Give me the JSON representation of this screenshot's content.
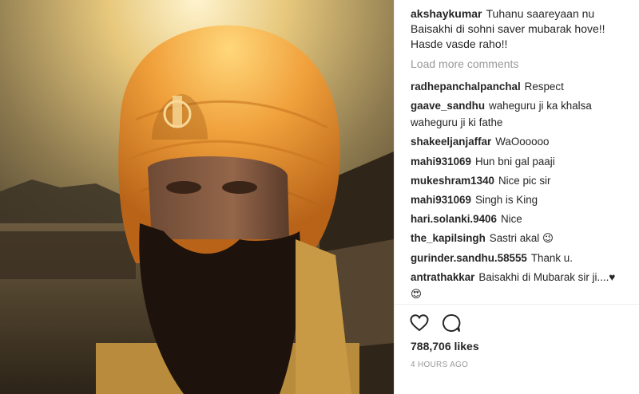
{
  "caption": {
    "username": "akshaykumar",
    "text": "Tuhanu saareyaan nu Baisakhi di sohni saver mubarak hove!! Hasde vasde raho!!"
  },
  "load_more_label": "Load more comments",
  "comments": [
    {
      "user": "radhepanchalpanchal",
      "text": "Respect"
    },
    {
      "user": "gaave_sandhu",
      "text": "waheguru ji ka khalsa waheguru ji ki fathe"
    },
    {
      "user": "shakeeljanjaffar",
      "text": "WaOooooo"
    },
    {
      "user": "mahi931069",
      "text": "Hun bni gal paaji"
    },
    {
      "user": "mukeshram1340",
      "text": "Nice pic sir"
    },
    {
      "user": "mahi931069",
      "text": "Singh is King"
    },
    {
      "user": "hari.solanki.9406",
      "text": "Nice"
    },
    {
      "user": "the_kapilsingh",
      "text": "Sastri akal 😉"
    },
    {
      "user": "gurinder.sandhu.58555",
      "text": "Thank u."
    },
    {
      "user": "antrathakkar",
      "text": "Baisakhi di Mubarak sir ji....♥ 😍"
    }
  ],
  "actions": {
    "like_icon": "heart-outline-icon",
    "comment_icon": "speech-bubble-icon"
  },
  "likes_text": "788,706 likes",
  "time_text": "4 HOURS AGO",
  "colors": {
    "text": "#262626",
    "muted": "#999999",
    "turban": "#e8912d",
    "beard": "#1d120c"
  }
}
